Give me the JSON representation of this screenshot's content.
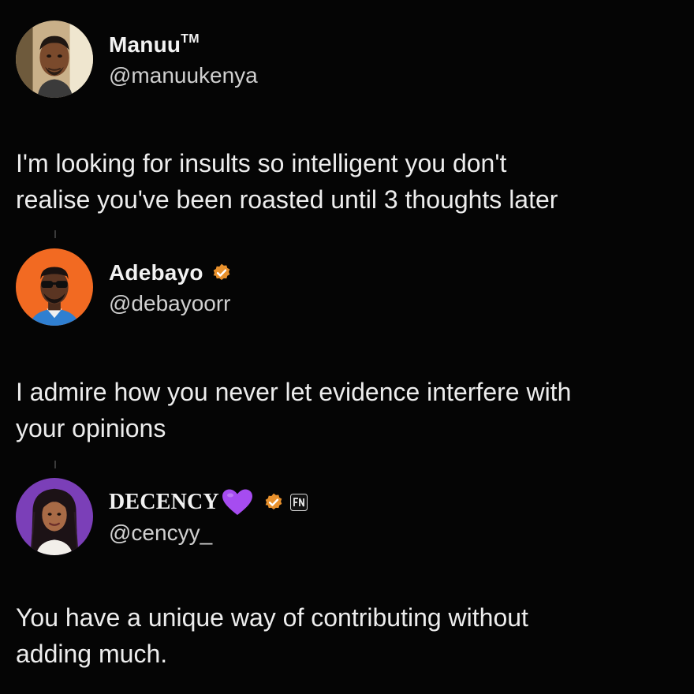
{
  "tweets": [
    {
      "name": "Manuu",
      "name_suffix": "TM",
      "handle": "@manuukenya",
      "text_lines": [
        "I'm looking for insults so intelligent you don't",
        "realise you've been roasted until 3 thoughts later"
      ],
      "avatar": "man-illustration-avatar",
      "verified": false
    },
    {
      "name": "Adebayo",
      "handle": "@debayoorr",
      "text_lines": [
        "I admire how you never let evidence interfere with",
        "your opinions"
      ],
      "avatar": "man-sunglasses-orange-avatar",
      "verified": true
    },
    {
      "name": "DECENCY",
      "handle": "@cencyy_",
      "text_lines": [
        "You have a unique way of contributing without",
        "adding much."
      ],
      "avatar": "woman-braids-purple-avatar",
      "verified": true,
      "extra_badges": [
        "purple-heart-icon",
        "fn-badge-icon"
      ]
    }
  ],
  "colors": {
    "background": "#050505",
    "verified": "#e8912d",
    "purple_heart": "#a64cf0",
    "text": "#ededed"
  }
}
